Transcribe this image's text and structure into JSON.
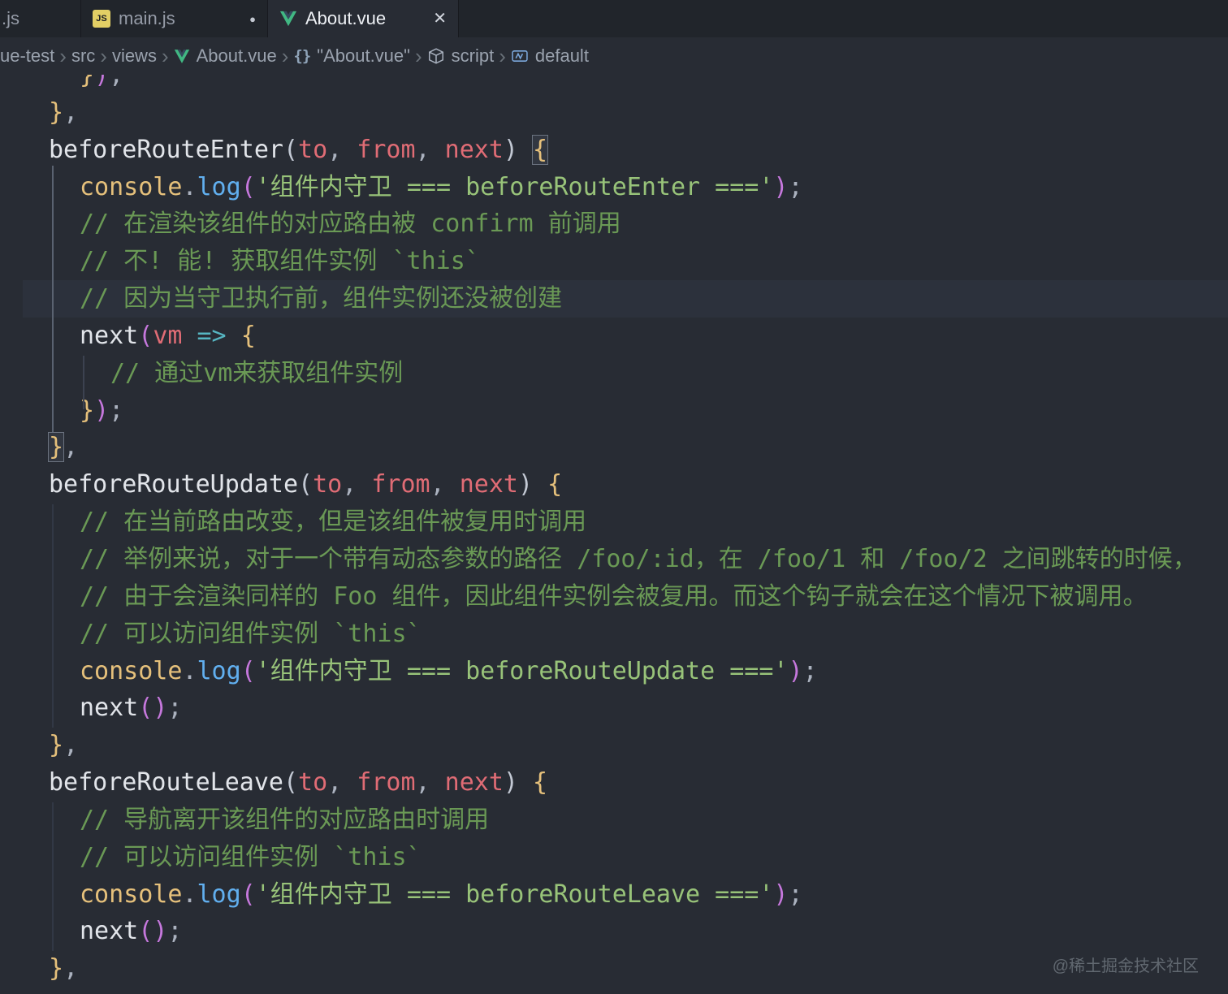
{
  "tabs": {
    "partial": {
      "label": ".js"
    },
    "main": {
      "label": "main.js"
    },
    "about": {
      "label": "About.vue"
    }
  },
  "glyphs": {
    "js_badge": "JS",
    "modified_dot": "●",
    "close": "✕",
    "separator": "›",
    "object_braces": "{}"
  },
  "breadcrumb": [
    "ue-test",
    "src",
    "views",
    "About.vue",
    "\"About.vue\"",
    "script",
    "default"
  ],
  "watermark": "@稀土掘金技术社区",
  "colors": {
    "background": "#282c34",
    "tabbar": "#21252b",
    "string": "#98c379",
    "comment": "#6a9955",
    "function": "#e2e5ea",
    "parameter": "#e06c75",
    "brace": "#e5c07b",
    "paren": "#c678dd",
    "vue_green": "#41b883",
    "js_yellow": "#e3cf65"
  },
  "code": {
    "lines": [
      {
        "indent": 2,
        "tokens": [
          [
            "br",
            "}"
          ],
          [
            "pr",
            ")"
          ],
          [
            "pc",
            ","
          ]
        ]
      },
      {
        "indent": 1,
        "tokens": [
          [
            "br",
            "}"
          ],
          [
            "pc",
            ","
          ]
        ]
      },
      {
        "indent": 1,
        "tokens": [
          [
            "fn",
            "beforeRouteEnter"
          ],
          [
            "sg",
            "("
          ],
          [
            "param",
            "to"
          ],
          [
            "pc",
            ", "
          ],
          [
            "param",
            "from"
          ],
          [
            "pc",
            ", "
          ],
          [
            "param",
            "next"
          ],
          [
            "sg",
            ")"
          ],
          [
            "pl",
            " "
          ],
          [
            "br bm",
            "{"
          ]
        ]
      },
      {
        "indent": 2,
        "tokens": [
          [
            "obj",
            "console"
          ],
          [
            "pc",
            "."
          ],
          [
            "prop",
            "log"
          ],
          [
            "pr",
            "("
          ],
          [
            "str",
            "'组件内守卫 === beforeRouteEnter ==='"
          ],
          [
            "pr",
            ")"
          ],
          [
            "pc",
            ";"
          ]
        ]
      },
      {
        "indent": 2,
        "tokens": [
          [
            "com",
            "// 在渲染该组件的对应路由被 confirm 前调用"
          ]
        ]
      },
      {
        "indent": 2,
        "tokens": [
          [
            "com",
            "// 不! 能! 获取组件实例 `this`"
          ]
        ]
      },
      {
        "indent": 2,
        "highlight": true,
        "tokens": [
          [
            "com",
            "// 因为当守卫执行前，组件实例还没被创建"
          ]
        ]
      },
      {
        "indent": 2,
        "tokens": [
          [
            "fn",
            "next"
          ],
          [
            "pr",
            "("
          ],
          [
            "param",
            "vm"
          ],
          [
            "pl",
            " "
          ],
          [
            "ar",
            "=>"
          ],
          [
            "pl",
            " "
          ],
          [
            "br",
            "{"
          ]
        ]
      },
      {
        "indent": 3,
        "tokens": [
          [
            "com",
            "// 通过vm来获取组件实例"
          ]
        ]
      },
      {
        "indent": 2,
        "tokens": [
          [
            "br",
            "}"
          ],
          [
            "pr",
            ")"
          ],
          [
            "pc",
            ";"
          ]
        ]
      },
      {
        "indent": 1,
        "tokens": [
          [
            "br bm",
            "}"
          ],
          [
            "pc",
            ","
          ]
        ]
      },
      {
        "indent": 1,
        "tokens": [
          [
            "fn",
            "beforeRouteUpdate"
          ],
          [
            "sg",
            "("
          ],
          [
            "param",
            "to"
          ],
          [
            "pc",
            ", "
          ],
          [
            "param",
            "from"
          ],
          [
            "pc",
            ", "
          ],
          [
            "param",
            "next"
          ],
          [
            "sg",
            ")"
          ],
          [
            "pl",
            " "
          ],
          [
            "br",
            "{"
          ]
        ]
      },
      {
        "indent": 2,
        "tokens": [
          [
            "com",
            "// 在当前路由改变，但是该组件被复用时调用"
          ]
        ]
      },
      {
        "indent": 2,
        "tokens": [
          [
            "com",
            "// 举例来说，对于一个带有动态参数的路径 /foo/:id，在 /foo/1 和 /foo/2 之间跳转的时候，"
          ]
        ]
      },
      {
        "indent": 2,
        "tokens": [
          [
            "com",
            "// 由于会渲染同样的 Foo 组件，因此组件实例会被复用。而这个钩子就会在这个情况下被调用。"
          ]
        ]
      },
      {
        "indent": 2,
        "tokens": [
          [
            "com",
            "// 可以访问组件实例 `this`"
          ]
        ]
      },
      {
        "indent": 2,
        "tokens": [
          [
            "obj",
            "console"
          ],
          [
            "pc",
            "."
          ],
          [
            "prop",
            "log"
          ],
          [
            "pr",
            "("
          ],
          [
            "str",
            "'组件内守卫 === beforeRouteUpdate ==='"
          ],
          [
            "pr",
            ")"
          ],
          [
            "pc",
            ";"
          ]
        ]
      },
      {
        "indent": 2,
        "tokens": [
          [
            "fn",
            "next"
          ],
          [
            "pr",
            "("
          ],
          [
            "pr",
            ")"
          ],
          [
            "pc",
            ";"
          ]
        ]
      },
      {
        "indent": 1,
        "tokens": [
          [
            "br",
            "}"
          ],
          [
            "pc",
            ","
          ]
        ]
      },
      {
        "indent": 1,
        "tokens": [
          [
            "fn",
            "beforeRouteLeave"
          ],
          [
            "sg",
            "("
          ],
          [
            "param",
            "to"
          ],
          [
            "pc",
            ", "
          ],
          [
            "param",
            "from"
          ],
          [
            "pc",
            ", "
          ],
          [
            "param",
            "next"
          ],
          [
            "sg",
            ")"
          ],
          [
            "pl",
            " "
          ],
          [
            "br",
            "{"
          ]
        ]
      },
      {
        "indent": 2,
        "tokens": [
          [
            "com",
            "// 导航离开该组件的对应路由时调用"
          ]
        ]
      },
      {
        "indent": 2,
        "tokens": [
          [
            "com",
            "// 可以访问组件实例 `this`"
          ]
        ]
      },
      {
        "indent": 2,
        "tokens": [
          [
            "obj",
            "console"
          ],
          [
            "pc",
            "."
          ],
          [
            "prop",
            "log"
          ],
          [
            "pr",
            "("
          ],
          [
            "str",
            "'组件内守卫 === beforeRouteLeave ==='"
          ],
          [
            "pr",
            ")"
          ],
          [
            "pc",
            ";"
          ]
        ]
      },
      {
        "indent": 2,
        "tokens": [
          [
            "fn",
            "next"
          ],
          [
            "pr",
            "("
          ],
          [
            "pr",
            ")"
          ],
          [
            "pc",
            ";"
          ]
        ]
      },
      {
        "indent": 1,
        "tokens": [
          [
            "br",
            "}"
          ],
          [
            "pc",
            ","
          ]
        ]
      }
    ]
  }
}
